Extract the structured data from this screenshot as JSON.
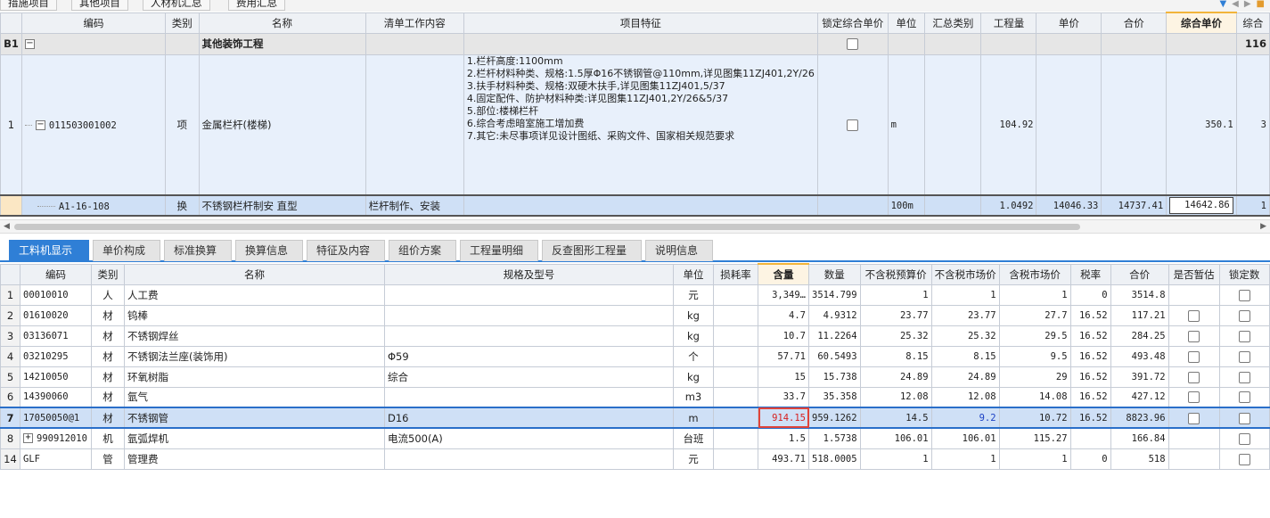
{
  "top_tabs": [
    "措施项目",
    "其他项目",
    "人材机汇总",
    "费用汇总"
  ],
  "grid1": {
    "headers": [
      "编码",
      "类别",
      "名称",
      "清单工作内容",
      "项目特征",
      "锁定综合单价",
      "单位",
      "汇总类别",
      "工程量",
      "单价",
      "合价",
      "综合单价",
      "综合"
    ],
    "section": {
      "idx": "B1",
      "name": "其他装饰工程",
      "price": "116"
    },
    "item": {
      "idx": "1",
      "code": "011503001002",
      "type": "项",
      "name": "金属栏杆(楼梯)",
      "features": [
        "1.栏杆高度:1100mm",
        "2.栏杆材料种类、规格:1.5厚Φ16不锈钢管@110mm,详见图集11ZJ401,2Y/26",
        "3.扶手材料种类、规格:双硬木扶手,详见图集11ZJ401,5/37",
        "4.固定配件、防护材料种类:详见图集11ZJ401,2Y/26&5/37",
        "5.部位:楼梯栏杆",
        "6.综合考虑暗室施工增加费",
        "7.其它:未尽事项详见设计图纸、采购文件、国家相关规范要求"
      ],
      "unit": "m",
      "quantity": "104.92",
      "comp_price": "350.1",
      "comp_total": "3"
    },
    "sub": {
      "code": "A1-16-108",
      "type": "换",
      "name": "不锈钢栏杆制安 直型",
      "work": "栏杆制作、安装",
      "unit": "100m",
      "quantity": "1.0492",
      "price": "14046.33",
      "total": "14737.41",
      "comp_price": "14642.86",
      "comp_total": "1"
    }
  },
  "tabs": [
    "工料机显示",
    "单价构成",
    "标准换算",
    "换算信息",
    "特征及内容",
    "组价方案",
    "工程量明细",
    "反查图形工程量",
    "说明信息"
  ],
  "grid2": {
    "headers": [
      "编码",
      "类别",
      "名称",
      "规格及型号",
      "单位",
      "损耗率",
      "含量",
      "数量",
      "不含税预算价",
      "不含税市场价",
      "含税市场价",
      "税率",
      "合价",
      "是否暂估",
      "锁定数"
    ],
    "rows": [
      {
        "idx": "1",
        "code": "00010010",
        "type": "人",
        "name": "人工费",
        "spec": "",
        "unit": "元",
        "loss": "",
        "content": "3,349…",
        "qty": "3514.799",
        "budget": "1",
        "market": "1",
        "market_tax": "1",
        "tax": "0",
        "total": "3514.8",
        "est": false
      },
      {
        "idx": "2",
        "code": "01610020",
        "type": "材",
        "name": "钨棒",
        "spec": "",
        "unit": "kg",
        "loss": "",
        "content": "4.7",
        "qty": "4.9312",
        "budget": "23.77",
        "market": "23.77",
        "market_tax": "27.7",
        "tax": "16.52",
        "total": "117.21",
        "est": true
      },
      {
        "idx": "3",
        "code": "03136071",
        "type": "材",
        "name": "不锈钢焊丝",
        "spec": "",
        "unit": "kg",
        "loss": "",
        "content": "10.7",
        "qty": "11.2264",
        "budget": "25.32",
        "market": "25.32",
        "market_tax": "29.5",
        "tax": "16.52",
        "total": "284.25",
        "est": true
      },
      {
        "idx": "4",
        "code": "03210295",
        "type": "材",
        "name": "不锈钢法兰座(装饰用)",
        "spec": "Φ59",
        "unit": "个",
        "loss": "",
        "content": "57.71",
        "qty": "60.5493",
        "budget": "8.15",
        "market": "8.15",
        "market_tax": "9.5",
        "tax": "16.52",
        "total": "493.48",
        "est": true
      },
      {
        "idx": "5",
        "code": "14210050",
        "type": "材",
        "name": "环氧树脂",
        "spec": "综合",
        "unit": "kg",
        "loss": "",
        "content": "15",
        "qty": "15.738",
        "budget": "24.89",
        "market": "24.89",
        "market_tax": "29",
        "tax": "16.52",
        "total": "391.72",
        "est": true
      },
      {
        "idx": "6",
        "code": "14390060",
        "type": "材",
        "name": "氩气",
        "spec": "",
        "unit": "m3",
        "loss": "",
        "content": "33.7",
        "qty": "35.358",
        "budget": "12.08",
        "market": "12.08",
        "market_tax": "14.08",
        "tax": "16.52",
        "total": "427.12",
        "est": true
      },
      {
        "idx": "7",
        "code": "17050050@1",
        "type": "材",
        "name": "不锈钢管",
        "spec": "D16",
        "unit": "m",
        "loss": "",
        "content": "914.15",
        "qty": "959.1262",
        "budget": "14.5",
        "market": "9.2",
        "market_tax": "10.72",
        "tax": "16.52",
        "total": "8823.96",
        "est": true
      },
      {
        "idx": "8",
        "code": "990912010",
        "type": "机",
        "name": "氩弧焊机",
        "spec": "电流500(A)",
        "unit": "台班",
        "loss": "",
        "content": "1.5",
        "qty": "1.5738",
        "budget": "106.01",
        "market": "106.01",
        "market_tax": "115.27",
        "tax": "",
        "total": "166.84",
        "est": false
      },
      {
        "idx": "14",
        "code": "GLF",
        "type": "管",
        "name": "管理费",
        "spec": "",
        "unit": "元",
        "loss": "",
        "content": "493.71",
        "qty": "518.0005",
        "budget": "1",
        "market": "1",
        "market_tax": "1",
        "tax": "0",
        "total": "518",
        "est": false
      }
    ]
  },
  "colors": {
    "accent": "#2f7fd6",
    "highlight_red": "#e0443a",
    "selected_row": "#cfe0f6"
  }
}
